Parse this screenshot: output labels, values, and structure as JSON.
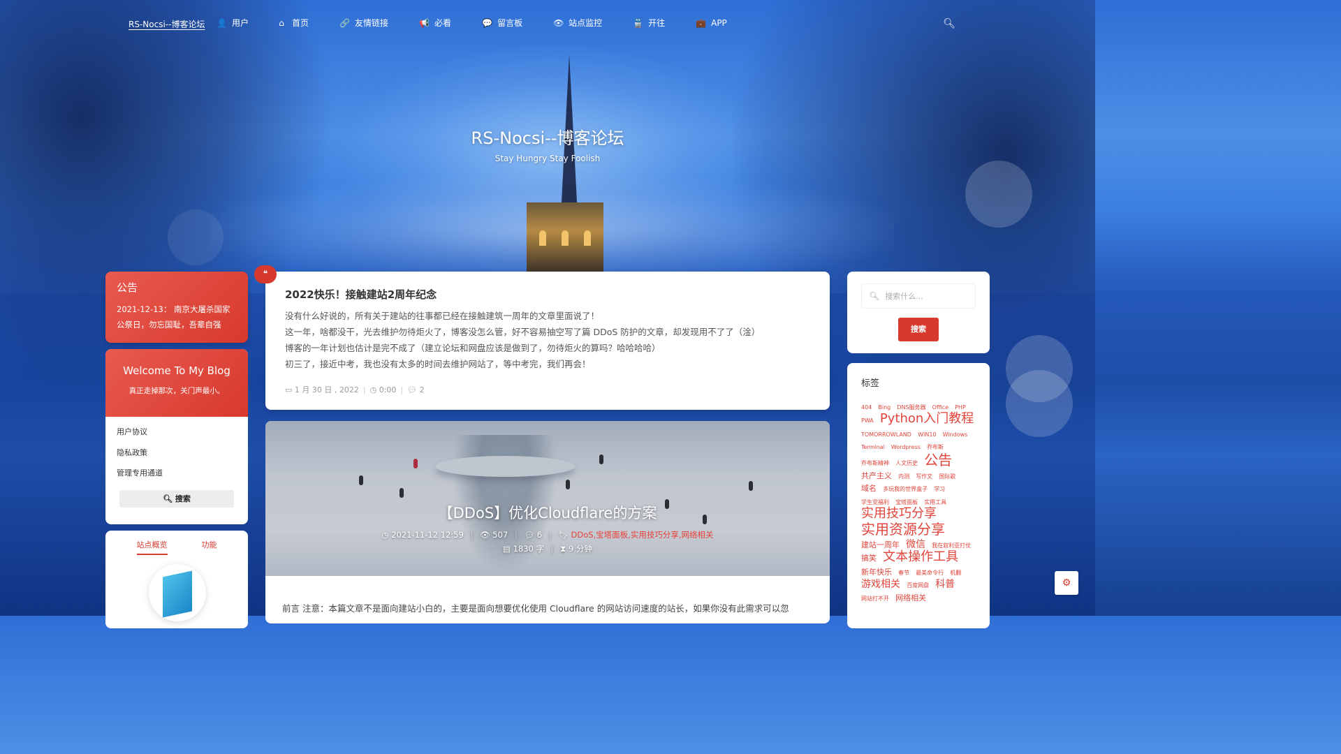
{
  "nav": {
    "brand": "RS-Nocsi--博客论坛",
    "items": [
      {
        "label": "用户",
        "icon": "user-icon",
        "glyph": "👤"
      },
      {
        "label": "首页",
        "icon": "home-icon",
        "glyph": "⌂"
      },
      {
        "label": "友情链接",
        "icon": "link-icon",
        "glyph": "🔗"
      },
      {
        "label": "必看",
        "icon": "bullhorn-icon",
        "glyph": "📢"
      },
      {
        "label": "留言板",
        "icon": "comment-icon",
        "glyph": "💬"
      },
      {
        "label": "站点监控",
        "icon": "eye-icon",
        "glyph": "👁"
      },
      {
        "label": "开往",
        "icon": "train-icon",
        "glyph": "🚆"
      },
      {
        "label": "APP",
        "icon": "briefcase-icon",
        "glyph": "💼"
      }
    ]
  },
  "hero": {
    "title": "RS-Nocsi--博客论坛",
    "subtitle": "Stay Hungry Stay Foolish"
  },
  "announcement": {
    "title": "公告",
    "text": "2021-12-13：  南京大屠杀国家公祭日，勿忘国耻，吾辈自强"
  },
  "welcome": {
    "title": "Welcome To My Blog",
    "subtitle": "真正走掉那次，关门声最小。",
    "links": [
      "用户协议",
      "隐私政策",
      "管理专用通道"
    ],
    "search_label": "搜索"
  },
  "site": {
    "tabs": [
      "站点概览",
      "功能"
    ]
  },
  "post1": {
    "quote_glyph": "❝",
    "title": "2022快乐！接触建站2周年纪念",
    "lines": [
      "没有什么好说的，所有关于建站的往事都已经在接触建筑一周年的文章里面说了！",
      "这一年，啥都没干，光去维护勿待炬火了，博客没怎么管，好不容易抽空写了篇 DDoS 防护的文章，却发现用不了了（淦）",
      "博客的一年计划也估计是完不成了（建立论坛和网盘应该是做到了，勿待炬火的算吗？哈哈哈哈）",
      "初三了，接近中考，我也没有太多的时间去维护网站了，等中考完，我们再会！"
    ],
    "date": "1 月 30 日 , 2022",
    "time": "0:00",
    "comments": "2"
  },
  "post2": {
    "title": "【DDoS】优化Cloudflare的方案",
    "date": "2021-11-12 12:59",
    "views": "507",
    "comments": "6",
    "tags": "DDoS,宝塔面板,实用技巧分享,网络相关",
    "words": "1830 字",
    "read_time": "9 分钟",
    "excerpt": "前言 注意：本篇文章不是面向建站小白的，主要是面向想要优化使用 Cloudflare 的网站访问速度的站长，如果你没有此需求可以忽"
  },
  "search": {
    "placeholder": "搜索什么...",
    "button": "搜索"
  },
  "tags": {
    "title": "标签",
    "items": [
      {
        "t": "404",
        "s": 1
      },
      {
        "t": "Bing",
        "s": 1
      },
      {
        "t": "DNS服务器",
        "s": 1
      },
      {
        "t": "Office",
        "s": 1
      },
      {
        "t": "PHP",
        "s": 1
      },
      {
        "t": "PWA",
        "s": 1
      },
      {
        "t": "Python入门教程",
        "s": 4
      },
      {
        "t": "TOMORROWLAND",
        "s": 1
      },
      {
        "t": "WIN10",
        "s": 1
      },
      {
        "t": "Windows",
        "s": 1
      },
      {
        "t": "Terminal",
        "s": 1
      },
      {
        "t": "Wordpress",
        "s": 1
      },
      {
        "t": "乔布斯",
        "s": 1
      },
      {
        "t": "乔布斯精神",
        "s": 1
      },
      {
        "t": "人文历史",
        "s": 1
      },
      {
        "t": "公告",
        "s": 5
      },
      {
        "t": "共产主义",
        "s": 2
      },
      {
        "t": "内测",
        "s": 1
      },
      {
        "t": "写作文",
        "s": 1
      },
      {
        "t": "国际歌",
        "s": 1
      },
      {
        "t": "域名",
        "s": 2
      },
      {
        "t": "多玩我的世界盒子",
        "s": 1
      },
      {
        "t": "学习",
        "s": 1
      },
      {
        "t": "学生党福利",
        "s": 1
      },
      {
        "t": "宝塔面板",
        "s": 1
      },
      {
        "t": "实用工具",
        "s": 1
      },
      {
        "t": "实用技巧分享",
        "s": 4
      },
      {
        "t": "实用资源分享",
        "s": 5
      },
      {
        "t": "建站一周年",
        "s": 2
      },
      {
        "t": "微信",
        "s": 3
      },
      {
        "t": "我在叙利亚打仗",
        "s": 1
      },
      {
        "t": "搞笑",
        "s": 2
      },
      {
        "t": "文本操作工具",
        "s": 4
      },
      {
        "t": "新年快乐",
        "s": 2
      },
      {
        "t": "春节",
        "s": 1
      },
      {
        "t": "最美命令行",
        "s": 1
      },
      {
        "t": "机翻",
        "s": 1
      },
      {
        "t": "游戏相关",
        "s": 3
      },
      {
        "t": "百度网盘",
        "s": 1
      },
      {
        "t": "科普",
        "s": 3
      },
      {
        "t": "网站打不开",
        "s": 1
      },
      {
        "t": "网络相关",
        "s": 2
      }
    ]
  },
  "float": {
    "gear_glyph": "⚙"
  }
}
